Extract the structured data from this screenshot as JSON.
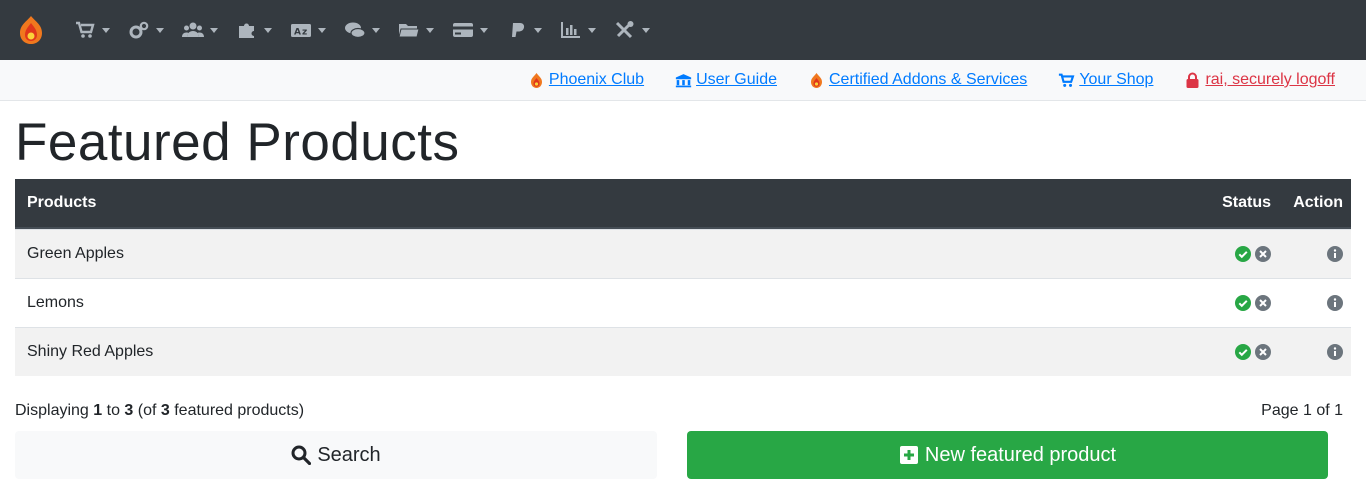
{
  "topnav": {
    "icons": [
      "phoenix-logo",
      "cart-icon",
      "cogs-icon",
      "users-icon",
      "puzzle-icon",
      "language-icon",
      "comments-icon",
      "folder-icon",
      "credit-card-icon",
      "paypal-icon",
      "chart-bar-icon",
      "tools-icon"
    ]
  },
  "links": [
    {
      "label": "Phoenix Club",
      "icon": "phoenix-icon"
    },
    {
      "label": "User Guide",
      "icon": "university-icon"
    },
    {
      "label": "Certified Addons & Services",
      "icon": "phoenix-icon"
    },
    {
      "label": "Your Shop",
      "icon": "cart-icon"
    },
    {
      "label": "rai, securely logoff",
      "icon": "lock-icon"
    }
  ],
  "page": {
    "title": "Featured Products"
  },
  "table": {
    "headers": {
      "products": "Products",
      "status": "Status",
      "action": "Action"
    },
    "rows": [
      {
        "name": "Green Apples"
      },
      {
        "name": "Lemons"
      },
      {
        "name": "Shiny Red Apples"
      }
    ]
  },
  "footer": {
    "displaying_prefix": "Displaying ",
    "from": "1",
    "to_word": " to ",
    "to": "3",
    "of_prefix": " (of ",
    "total": "3",
    "of_suffix": " featured products)",
    "pagination": "Page 1 of 1"
  },
  "buttons": {
    "search": "Search",
    "new": "New featured product"
  },
  "colors": {
    "nav_bg": "#343a40",
    "link": "#007bff",
    "danger": "#dc3545",
    "success": "#28a745",
    "muted_icon": "#6c757d"
  }
}
